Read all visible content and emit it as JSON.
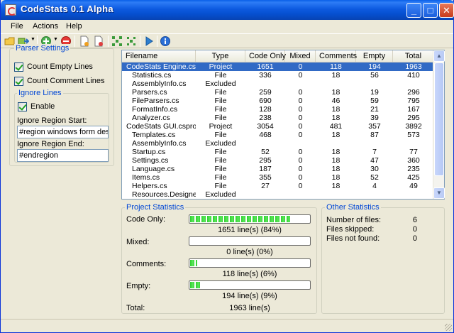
{
  "window": {
    "title": "CodeStats 0.1 Alpha"
  },
  "captions": {
    "minimize": "_",
    "maximize": "□",
    "close": "✕"
  },
  "menu": [
    "File",
    "Actions",
    "Help"
  ],
  "toolbar": {
    "icons": [
      "open-folder-icon",
      "export-icon",
      "add-icon",
      "remove-icon",
      "new-file-icon",
      "delete-file-icon",
      "expand-icon",
      "collapse-icon",
      "run-icon",
      "info-icon"
    ]
  },
  "parser_settings": {
    "title": "Parser Settings",
    "count_empty": "Count Empty Lines",
    "count_comment": "Count Comment Lines",
    "ignore_title": "Ignore Lines",
    "enable": "Enable",
    "start_label": "Ignore Region Start:",
    "start_value": "#region windows form designe",
    "end_label": "Ignore Region End:",
    "end_value": "#endregion"
  },
  "table": {
    "columns": [
      "Filename",
      "Type",
      "Code Only",
      "Mixed",
      "Comments",
      "Empty",
      "Total"
    ],
    "rows": [
      [
        "CodeStats Engine.cs...",
        "Project",
        "1651",
        "0",
        "118",
        "194",
        "1963"
      ],
      [
        "Statistics.cs",
        "File",
        "336",
        "0",
        "18",
        "56",
        "410"
      ],
      [
        "AssemblyInfo.cs",
        "Excluded",
        "",
        "",
        "",
        "",
        ""
      ],
      [
        "Parsers.cs",
        "File",
        "259",
        "0",
        "18",
        "19",
        "296"
      ],
      [
        "FileParsers.cs",
        "File",
        "690",
        "0",
        "46",
        "59",
        "795"
      ],
      [
        "FormatInfo.cs",
        "File",
        "128",
        "0",
        "18",
        "21",
        "167"
      ],
      [
        "Analyzer.cs",
        "File",
        "238",
        "0",
        "18",
        "39",
        "295"
      ],
      [
        "CodeStats GUI.csproj",
        "Project",
        "3054",
        "0",
        "481",
        "357",
        "3892"
      ],
      [
        "Templates.cs",
        "File",
        "468",
        "0",
        "18",
        "87",
        "573"
      ],
      [
        "AssemblyInfo.cs",
        "Excluded",
        "",
        "",
        "",
        "",
        ""
      ],
      [
        "Startup.cs",
        "File",
        "52",
        "0",
        "18",
        "7",
        "77"
      ],
      [
        "Settings.cs",
        "File",
        "295",
        "0",
        "18",
        "47",
        "360"
      ],
      [
        "Language.cs",
        "File",
        "187",
        "0",
        "18",
        "30",
        "235"
      ],
      [
        "Items.cs",
        "File",
        "355",
        "0",
        "18",
        "52",
        "425"
      ],
      [
        "Helpers.cs",
        "File",
        "27",
        "0",
        "18",
        "4",
        "49"
      ],
      [
        "Resources.Designe...",
        "Excluded",
        "",
        "",
        "",
        "",
        ""
      ]
    ]
  },
  "project_stats": {
    "title": "Project Statistics",
    "items": [
      {
        "label": "Code Only:",
        "value": "1651 line(s) (84%)",
        "percent": 84
      },
      {
        "label": "Mixed:",
        "value": "0 line(s) (0%)",
        "percent": 0
      },
      {
        "label": "Comments:",
        "value": "118 line(s) (6%)",
        "percent": 6
      },
      {
        "label": "Empty:",
        "value": "194 line(s) (9%)",
        "percent": 9
      }
    ],
    "total_label": "Total:",
    "total_value": "1963 line(s)"
  },
  "other_stats": {
    "title": "Other Statistics",
    "items": [
      {
        "label": "Number of files:",
        "value": "6"
      },
      {
        "label": "Files skipped:",
        "value": "0"
      },
      {
        "label": "Files not found:",
        "value": "0"
      }
    ]
  }
}
